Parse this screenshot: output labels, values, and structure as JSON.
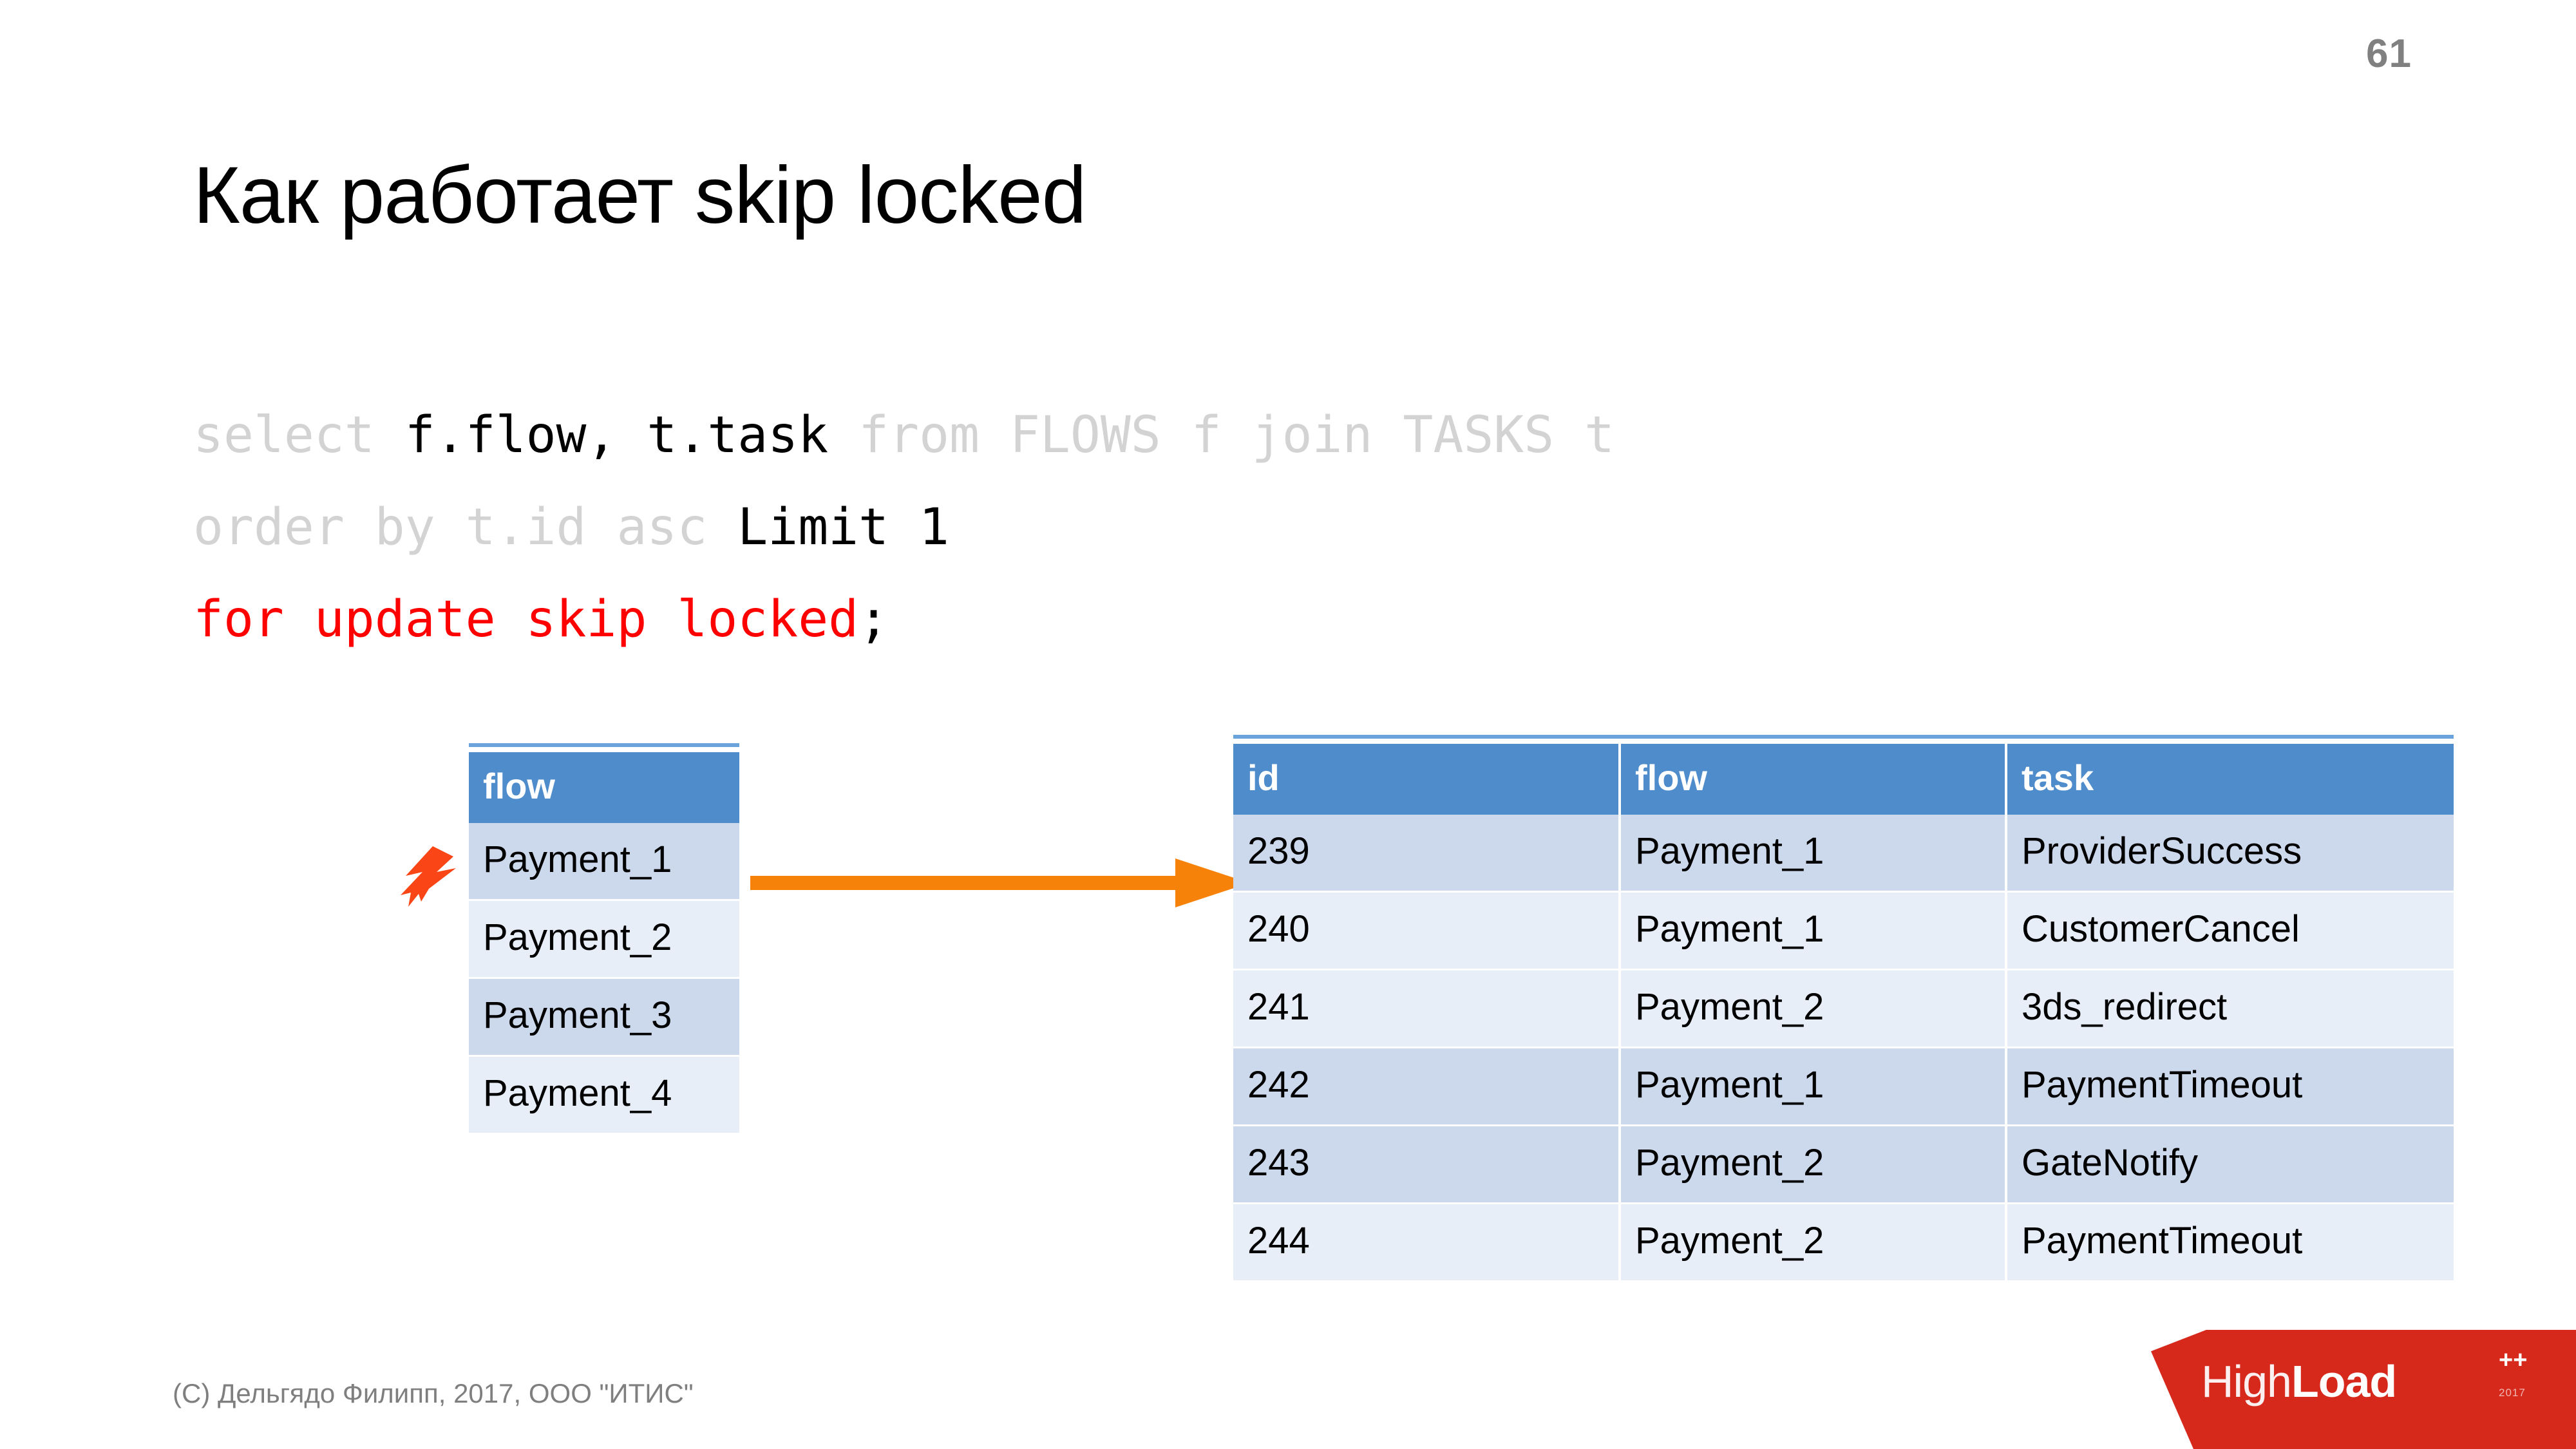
{
  "slide": {
    "number": "61",
    "title": "Как работает skip locked"
  },
  "code": {
    "line1_part1": "select ",
    "line1_part2": "f.flow, t.task",
    "line1_part3": " from FLOWS f join TASKS t",
    "line2_part1": "order by t.id asc ",
    "line2_part2": "Limit 1",
    "line3_part1": "for update skip locked",
    "line3_part2": ";"
  },
  "flow_table": {
    "header": "flow",
    "rows": [
      {
        "flow": "Payment_1"
      },
      {
        "flow": "Payment_2"
      },
      {
        "flow": "Payment_3"
      },
      {
        "flow": "Payment_4"
      }
    ]
  },
  "tasks_table": {
    "headers": {
      "id": "id",
      "flow": "flow",
      "task": "task"
    },
    "rows": [
      {
        "id": "239",
        "flow": "Payment_1",
        "task": "ProviderSuccess"
      },
      {
        "id": "240",
        "flow": "Payment_1",
        "task": "CustomerCancel"
      },
      {
        "id": "241",
        "flow": "Payment_2",
        "task": "3ds_redirect"
      },
      {
        "id": "242",
        "flow": "Payment_1",
        "task": "PaymentTimeout"
      },
      {
        "id": "243",
        "flow": "Payment_2",
        "task": "GateNotify"
      },
      {
        "id": "244",
        "flow": "Payment_2",
        "task": "PaymentTimeout"
      }
    ]
  },
  "footer": {
    "copyright": "(C) Дельгядо Филипп, 2017, ООО \"ИТИС\""
  },
  "logo": {
    "high": "High",
    "load": "Load",
    "plus": "++",
    "sub": "2017"
  },
  "icons": {
    "lightning": "lightning-bolt-icon",
    "arrow": "right-arrow-icon"
  },
  "colors": {
    "table_header": "#4f8ccc",
    "row_dark": "#ccd9ec",
    "row_light": "#e8eef8",
    "arrow": "#f7820a",
    "bolt": "#fa4616",
    "code_accent": "#ff0000",
    "code_dim": "#d3d3d3",
    "logo_red": "#d6291c",
    "slide_number": "#808080"
  }
}
